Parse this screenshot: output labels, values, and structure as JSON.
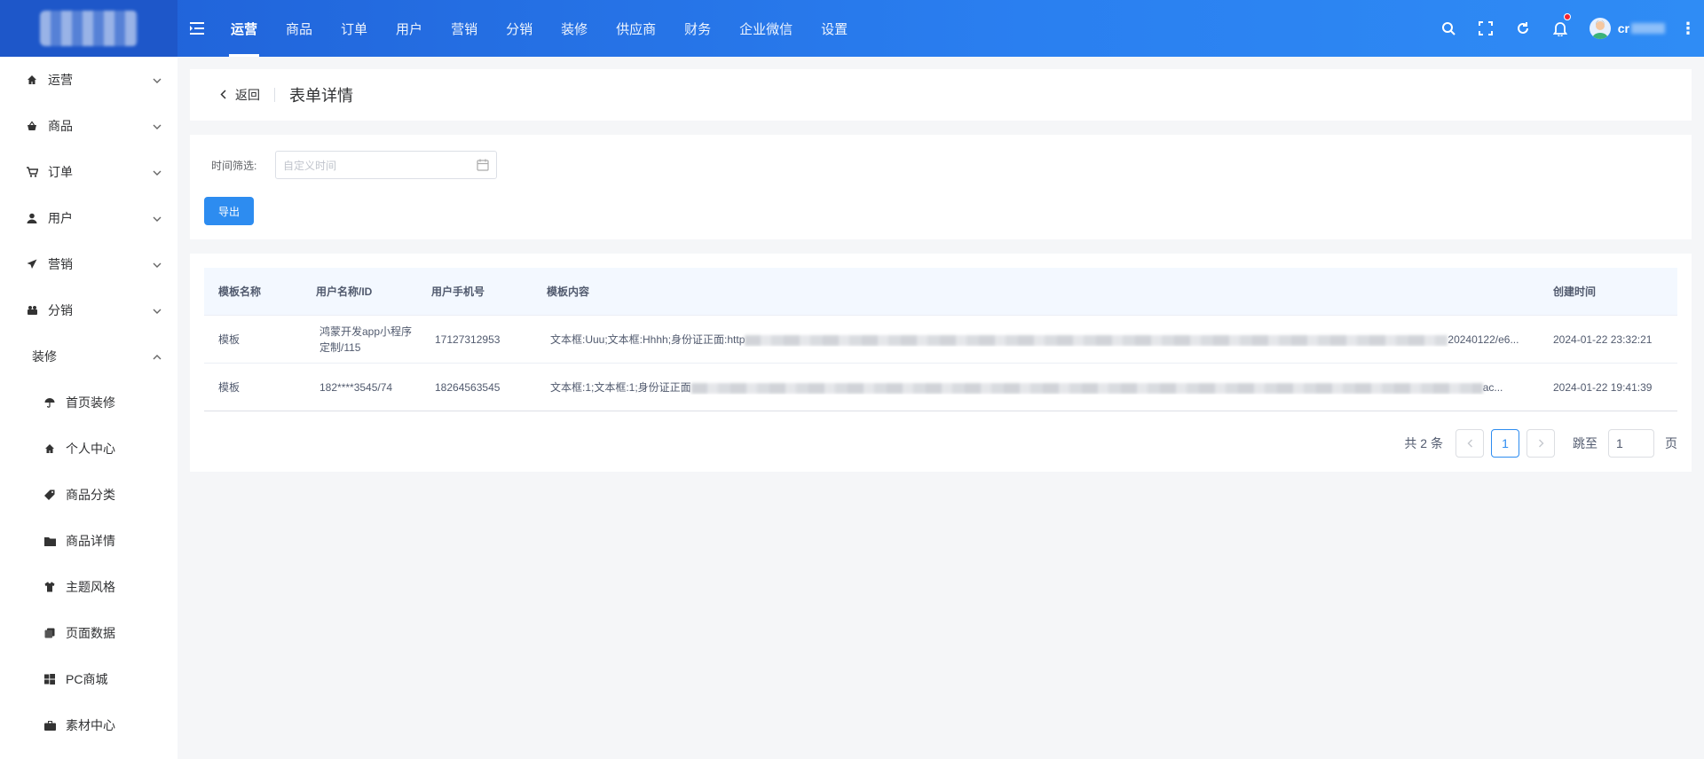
{
  "topbar": {
    "nav": [
      "运营",
      "商品",
      "订单",
      "用户",
      "营销",
      "分销",
      "装修",
      "供应商",
      "财务",
      "企业微信",
      "设置"
    ],
    "active_nav": "运营",
    "user_name": "cr",
    "colors": {
      "primary": "#2a7ff0",
      "badge": "#f5222d"
    }
  },
  "sidebar": {
    "items": [
      {
        "label": "运营",
        "icon": "home-icon"
      },
      {
        "label": "商品",
        "icon": "basket-icon"
      },
      {
        "label": "订单",
        "icon": "cart-icon"
      },
      {
        "label": "用户",
        "icon": "user-icon"
      },
      {
        "label": "营销",
        "icon": "send-icon"
      },
      {
        "label": "分销",
        "icon": "distribution-icon"
      }
    ],
    "expanded": {
      "label": "装修",
      "children": [
        {
          "label": "首页装修",
          "icon": "umbrella-icon"
        },
        {
          "label": "个人中心",
          "icon": "home-icon"
        },
        {
          "label": "商品分类",
          "icon": "tag-icon"
        },
        {
          "label": "商品详情",
          "icon": "folder-icon"
        },
        {
          "label": "主题风格",
          "icon": "shirt-icon"
        },
        {
          "label": "页面数据",
          "icon": "copy-icon"
        },
        {
          "label": "PC商城",
          "icon": "windows-icon"
        },
        {
          "label": "素材中心",
          "icon": "briefcase-icon"
        }
      ]
    }
  },
  "header": {
    "back_label": "返回",
    "title": "表单详情"
  },
  "filter": {
    "label": "时间筛选:",
    "date_placeholder": "自定义时间",
    "export_label": "导出"
  },
  "table": {
    "columns": [
      "模板名称",
      "用户名称/ID",
      "用户手机号",
      "模板内容",
      "创建时间"
    ],
    "rows": [
      {
        "template": "模板",
        "user": "鸿蒙开发app小程序定制/115",
        "phone": "17127312953",
        "content_start": "文本框:Uuu;文本框:Hhhh;身份证正面:http",
        "content_end": "20240122/e6...",
        "created": "2024-01-22 23:32:21"
      },
      {
        "template": "模板",
        "user": "182****3545/74",
        "phone": "18264563545",
        "content_start": "文本框:1;文本框:1;身份证正面",
        "content_end": "ac...",
        "created": "2024-01-22 19:41:39"
      }
    ]
  },
  "pagination": {
    "total_text": "共 2 条",
    "current_page": "1",
    "jump_label": "跳至",
    "jump_value": "1",
    "page_suffix": "页"
  }
}
